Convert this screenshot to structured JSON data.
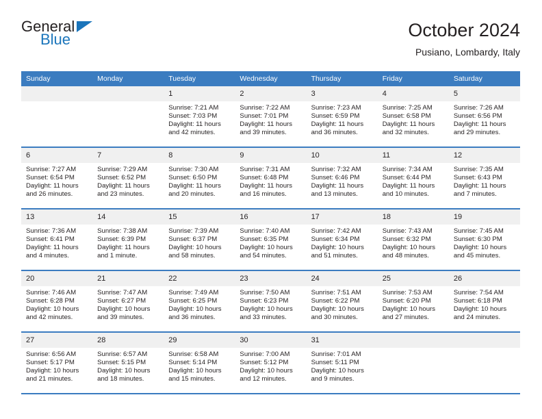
{
  "brand": {
    "name_part1": "General",
    "name_part2": "Blue",
    "triangle_icon": "triangle-right-icon",
    "colors": {
      "blue": "#1b75bb",
      "dark": "#231f20"
    }
  },
  "header": {
    "title": "October 2024",
    "subtitle": "Pusiano, Lombardy, Italy"
  },
  "theme": {
    "header_band": "#3b7cc0",
    "daynum_band": "#f0f0f0",
    "row_divider": "#3b7cc0",
    "text": "#231f20",
    "page_background": "#ffffff"
  },
  "calendar": {
    "weekday_headers": [
      "Sunday",
      "Monday",
      "Tuesday",
      "Wednesday",
      "Thursday",
      "Friday",
      "Saturday"
    ],
    "weeks": [
      [
        {
          "day": "",
          "empty": true
        },
        {
          "day": "",
          "empty": true
        },
        {
          "day": "1",
          "sunrise": "Sunrise: 7:21 AM",
          "sunset": "Sunset: 7:03 PM",
          "daylight_line1": "Daylight: 11 hours",
          "daylight_line2": "and 42 minutes."
        },
        {
          "day": "2",
          "sunrise": "Sunrise: 7:22 AM",
          "sunset": "Sunset: 7:01 PM",
          "daylight_line1": "Daylight: 11 hours",
          "daylight_line2": "and 39 minutes."
        },
        {
          "day": "3",
          "sunrise": "Sunrise: 7:23 AM",
          "sunset": "Sunset: 6:59 PM",
          "daylight_line1": "Daylight: 11 hours",
          "daylight_line2": "and 36 minutes."
        },
        {
          "day": "4",
          "sunrise": "Sunrise: 7:25 AM",
          "sunset": "Sunset: 6:58 PM",
          "daylight_line1": "Daylight: 11 hours",
          "daylight_line2": "and 32 minutes."
        },
        {
          "day": "5",
          "sunrise": "Sunrise: 7:26 AM",
          "sunset": "Sunset: 6:56 PM",
          "daylight_line1": "Daylight: 11 hours",
          "daylight_line2": "and 29 minutes."
        }
      ],
      [
        {
          "day": "6",
          "sunrise": "Sunrise: 7:27 AM",
          "sunset": "Sunset: 6:54 PM",
          "daylight_line1": "Daylight: 11 hours",
          "daylight_line2": "and 26 minutes."
        },
        {
          "day": "7",
          "sunrise": "Sunrise: 7:29 AM",
          "sunset": "Sunset: 6:52 PM",
          "daylight_line1": "Daylight: 11 hours",
          "daylight_line2": "and 23 minutes."
        },
        {
          "day": "8",
          "sunrise": "Sunrise: 7:30 AM",
          "sunset": "Sunset: 6:50 PM",
          "daylight_line1": "Daylight: 11 hours",
          "daylight_line2": "and 20 minutes."
        },
        {
          "day": "9",
          "sunrise": "Sunrise: 7:31 AM",
          "sunset": "Sunset: 6:48 PM",
          "daylight_line1": "Daylight: 11 hours",
          "daylight_line2": "and 16 minutes."
        },
        {
          "day": "10",
          "sunrise": "Sunrise: 7:32 AM",
          "sunset": "Sunset: 6:46 PM",
          "daylight_line1": "Daylight: 11 hours",
          "daylight_line2": "and 13 minutes."
        },
        {
          "day": "11",
          "sunrise": "Sunrise: 7:34 AM",
          "sunset": "Sunset: 6:44 PM",
          "daylight_line1": "Daylight: 11 hours",
          "daylight_line2": "and 10 minutes."
        },
        {
          "day": "12",
          "sunrise": "Sunrise: 7:35 AM",
          "sunset": "Sunset: 6:43 PM",
          "daylight_line1": "Daylight: 11 hours",
          "daylight_line2": "and 7 minutes."
        }
      ],
      [
        {
          "day": "13",
          "sunrise": "Sunrise: 7:36 AM",
          "sunset": "Sunset: 6:41 PM",
          "daylight_line1": "Daylight: 11 hours",
          "daylight_line2": "and 4 minutes."
        },
        {
          "day": "14",
          "sunrise": "Sunrise: 7:38 AM",
          "sunset": "Sunset: 6:39 PM",
          "daylight_line1": "Daylight: 11 hours",
          "daylight_line2": "and 1 minute."
        },
        {
          "day": "15",
          "sunrise": "Sunrise: 7:39 AM",
          "sunset": "Sunset: 6:37 PM",
          "daylight_line1": "Daylight: 10 hours",
          "daylight_line2": "and 58 minutes."
        },
        {
          "day": "16",
          "sunrise": "Sunrise: 7:40 AM",
          "sunset": "Sunset: 6:35 PM",
          "daylight_line1": "Daylight: 10 hours",
          "daylight_line2": "and 54 minutes."
        },
        {
          "day": "17",
          "sunrise": "Sunrise: 7:42 AM",
          "sunset": "Sunset: 6:34 PM",
          "daylight_line1": "Daylight: 10 hours",
          "daylight_line2": "and 51 minutes."
        },
        {
          "day": "18",
          "sunrise": "Sunrise: 7:43 AM",
          "sunset": "Sunset: 6:32 PM",
          "daylight_line1": "Daylight: 10 hours",
          "daylight_line2": "and 48 minutes."
        },
        {
          "day": "19",
          "sunrise": "Sunrise: 7:45 AM",
          "sunset": "Sunset: 6:30 PM",
          "daylight_line1": "Daylight: 10 hours",
          "daylight_line2": "and 45 minutes."
        }
      ],
      [
        {
          "day": "20",
          "sunrise": "Sunrise: 7:46 AM",
          "sunset": "Sunset: 6:28 PM",
          "daylight_line1": "Daylight: 10 hours",
          "daylight_line2": "and 42 minutes."
        },
        {
          "day": "21",
          "sunrise": "Sunrise: 7:47 AM",
          "sunset": "Sunset: 6:27 PM",
          "daylight_line1": "Daylight: 10 hours",
          "daylight_line2": "and 39 minutes."
        },
        {
          "day": "22",
          "sunrise": "Sunrise: 7:49 AM",
          "sunset": "Sunset: 6:25 PM",
          "daylight_line1": "Daylight: 10 hours",
          "daylight_line2": "and 36 minutes."
        },
        {
          "day": "23",
          "sunrise": "Sunrise: 7:50 AM",
          "sunset": "Sunset: 6:23 PM",
          "daylight_line1": "Daylight: 10 hours",
          "daylight_line2": "and 33 minutes."
        },
        {
          "day": "24",
          "sunrise": "Sunrise: 7:51 AM",
          "sunset": "Sunset: 6:22 PM",
          "daylight_line1": "Daylight: 10 hours",
          "daylight_line2": "and 30 minutes."
        },
        {
          "day": "25",
          "sunrise": "Sunrise: 7:53 AM",
          "sunset": "Sunset: 6:20 PM",
          "daylight_line1": "Daylight: 10 hours",
          "daylight_line2": "and 27 minutes."
        },
        {
          "day": "26",
          "sunrise": "Sunrise: 7:54 AM",
          "sunset": "Sunset: 6:18 PM",
          "daylight_line1": "Daylight: 10 hours",
          "daylight_line2": "and 24 minutes."
        }
      ],
      [
        {
          "day": "27",
          "sunrise": "Sunrise: 6:56 AM",
          "sunset": "Sunset: 5:17 PM",
          "daylight_line1": "Daylight: 10 hours",
          "daylight_line2": "and 21 minutes."
        },
        {
          "day": "28",
          "sunrise": "Sunrise: 6:57 AM",
          "sunset": "Sunset: 5:15 PM",
          "daylight_line1": "Daylight: 10 hours",
          "daylight_line2": "and 18 minutes."
        },
        {
          "day": "29",
          "sunrise": "Sunrise: 6:58 AM",
          "sunset": "Sunset: 5:14 PM",
          "daylight_line1": "Daylight: 10 hours",
          "daylight_line2": "and 15 minutes."
        },
        {
          "day": "30",
          "sunrise": "Sunrise: 7:00 AM",
          "sunset": "Sunset: 5:12 PM",
          "daylight_line1": "Daylight: 10 hours",
          "daylight_line2": "and 12 minutes."
        },
        {
          "day": "31",
          "sunrise": "Sunrise: 7:01 AM",
          "sunset": "Sunset: 5:11 PM",
          "daylight_line1": "Daylight: 10 hours",
          "daylight_line2": "and 9 minutes."
        },
        {
          "day": "",
          "empty": true
        },
        {
          "day": "",
          "empty": true
        }
      ]
    ]
  }
}
